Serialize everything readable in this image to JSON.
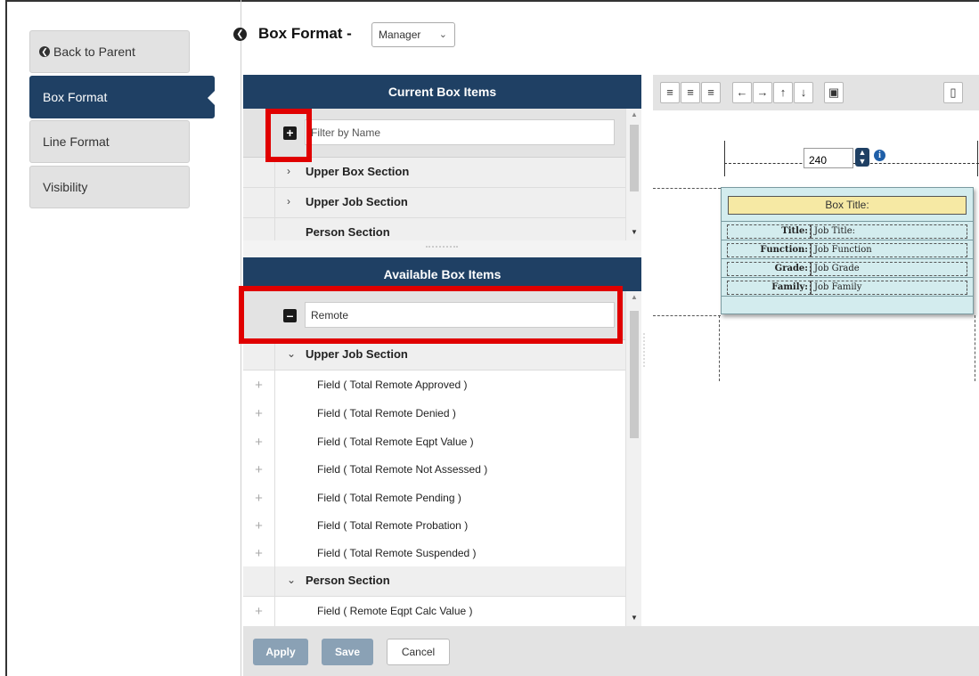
{
  "nav": {
    "back_label": "Back to Parent",
    "items": [
      {
        "label": "Box Format",
        "active": true
      },
      {
        "label": "Line Format",
        "active": false
      },
      {
        "label": "Visibility",
        "active": false
      }
    ]
  },
  "header": {
    "title": "Box Format -",
    "view_select": "Manager"
  },
  "current_box_items": {
    "title": "Current Box Items",
    "filter_placeholder": "Filter by Name",
    "filter_value": "",
    "sections": [
      {
        "label": "Upper Box Section",
        "expanded": false
      },
      {
        "label": "Upper Job Section",
        "expanded": false
      },
      {
        "label": "Person Section",
        "expanded": false
      }
    ]
  },
  "available_box_items": {
    "title": "Available Box Items",
    "filter_value": "Remote",
    "groups": [
      {
        "label": "Upper Job Section",
        "expanded": true,
        "fields": [
          "Field ( Total Remote Approved )",
          "Field ( Total Remote Denied )",
          "Field ( Total Remote Eqpt Value )",
          "Field ( Total Remote Not Assessed )",
          "Field ( Total Remote Pending )",
          "Field ( Total Remote Probation )",
          "Field ( Total Remote Suspended )"
        ]
      },
      {
        "label": "Person Section",
        "expanded": true,
        "fields": [
          "Field ( Remote Eqpt Calc Value )"
        ]
      }
    ]
  },
  "toolbar": {
    "buttons": [
      "align-left-icon",
      "align-center-icon",
      "align-right-icon",
      "arrow-left-icon",
      "arrow-right-icon",
      "arrow-up-icon",
      "arrow-down-icon",
      "fit-frame-icon",
      "trash-icon"
    ]
  },
  "editor": {
    "box_width": "240",
    "box_title": "Box Title:",
    "rows": [
      {
        "label": "Title:",
        "value": "Job Title:"
      },
      {
        "label": "Function:",
        "value": "Job Function"
      },
      {
        "label": "Grade:",
        "value": "Job Grade"
      },
      {
        "label": "Family:",
        "value": "Job Family"
      }
    ]
  },
  "footer": {
    "apply_label": "Apply",
    "save_label": "Save",
    "cancel_label": "Cancel"
  },
  "colors": {
    "navy": "#1f4064",
    "highlight": "#e00000",
    "preview_bg": "#d3ecee",
    "title_bg": "#f6e9a4"
  }
}
